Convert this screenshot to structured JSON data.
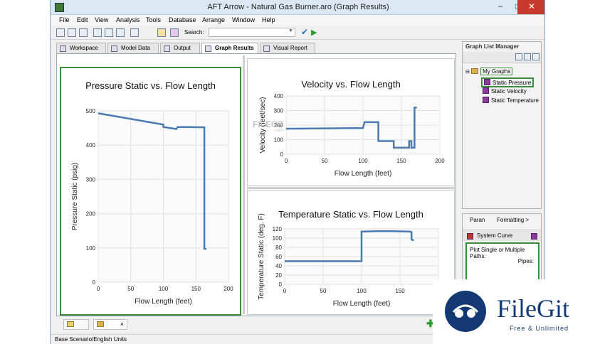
{
  "window": {
    "title": "AFT Arrow - Natural Gas Burner.aro (Graph Results)",
    "minimize": "−",
    "maximize": "□",
    "close": "✕"
  },
  "menu": [
    "File",
    "Edit",
    "View",
    "Analysis",
    "Tools",
    "Database",
    "Arrange",
    "Window",
    "Help"
  ],
  "toolbar": {
    "search_label": "Search:",
    "search_value": ""
  },
  "tabs": [
    {
      "label": "Workspace",
      "icon": "workspace-icon"
    },
    {
      "label": "Model Data",
      "icon": "model-data-icon"
    },
    {
      "label": "Output",
      "icon": "output-icon"
    },
    {
      "label": "Graph Results",
      "icon": "graph-icon",
      "active": true
    },
    {
      "label": "Visual Report",
      "icon": "visual-report-icon"
    }
  ],
  "graph_list": {
    "title": "Graph List Manager",
    "root": "My Graphs",
    "items": [
      "Static Pressure",
      "Static Velocity",
      "Static Temperature"
    ]
  },
  "lower_right": {
    "tab_param": "Paran",
    "tab_formatting": "Formatting >",
    "system_curve": "System Curve",
    "plot_label": "Plot Single or Multiple Paths:",
    "pipes_label": "Pipes:"
  },
  "bottom_tabs": {
    "close": "×"
  },
  "status": {
    "text": "Base Scenario/English Units"
  },
  "watermarks": {
    "filecr": "FILECR",
    "filecr_sub": ".com",
    "filegit": "FileGit",
    "filegit_sub": "Free & Unlimited"
  },
  "colors": {
    "series": "#4a7ab0",
    "selected_border": "#3a8d3a",
    "grid": "#e2e2e2"
  },
  "chart_data": [
    {
      "type": "line",
      "title": "Pressure Static vs. Flow Length",
      "xlabel": "Flow Length (feet)",
      "ylabel": "Pressure Static (psig)",
      "xlim": [
        0,
        200
      ],
      "ylim": [
        0,
        500
      ],
      "xticks": [
        0,
        50,
        100,
        150,
        200
      ],
      "yticks": [
        0,
        100,
        200,
        300,
        400,
        500
      ],
      "grid": true,
      "series": [
        {
          "x": [
            0,
            100,
            100,
            120,
            122,
            135,
            163,
            163,
            166
          ],
          "y": [
            493,
            460,
            453,
            447,
            453,
            453,
            452,
            98,
            96
          ]
        }
      ]
    },
    {
      "type": "line",
      "title": "Velocity vs. Flow Length",
      "xlabel": "Flow Length (feet)",
      "ylabel": "Velocity (feet/sec)",
      "xlim": [
        0,
        200
      ],
      "ylim": [
        0,
        400
      ],
      "xticks": [
        0,
        50,
        100,
        150,
        200
      ],
      "yticks": [
        0,
        100,
        200,
        300,
        400
      ],
      "grid": true,
      "series": [
        {
          "x": [
            0,
            100,
            102,
            120,
            120,
            140,
            140,
            160,
            160,
            163,
            163,
            167,
            167,
            170
          ],
          "y": [
            175,
            180,
            220,
            220,
            90,
            90,
            45,
            45,
            90,
            90,
            45,
            45,
            320,
            320
          ]
        }
      ]
    },
    {
      "type": "line",
      "title": "Temperature Static vs. Flow Length",
      "xlabel": "Flow Length (feet)",
      "ylabel": "Temperature Static (deg. F)",
      "xlim": [
        0,
        200
      ],
      "ylim": [
        0,
        120
      ],
      "xticks": [
        0,
        50,
        100,
        150,
        200
      ],
      "yticks": [
        0,
        20,
        40,
        60,
        80,
        100,
        120
      ],
      "grid": true,
      "series": [
        {
          "x": [
            0,
            100,
            100,
            120,
            140,
            163,
            165,
            165,
            168
          ],
          "y": [
            50,
            50,
            114,
            115,
            115,
            114,
            113,
            97,
            95
          ]
        }
      ]
    }
  ]
}
